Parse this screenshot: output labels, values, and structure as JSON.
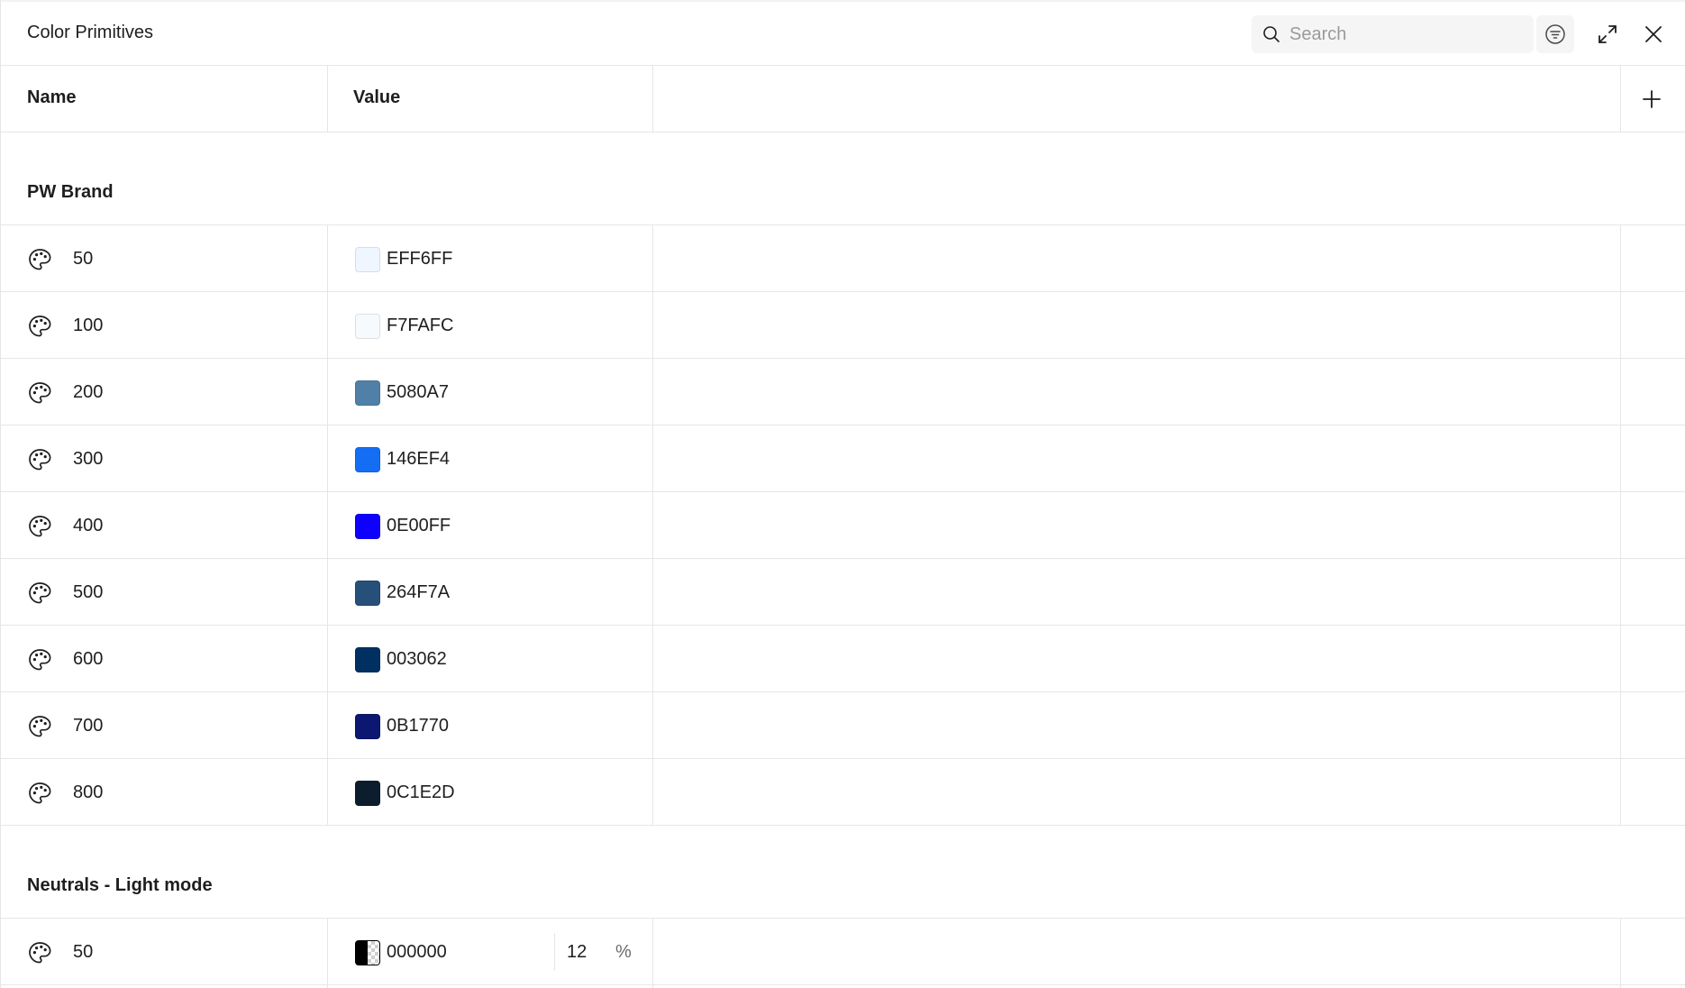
{
  "header": {
    "title": "Color Primitives",
    "search_placeholder": "Search"
  },
  "columns": {
    "name": "Name",
    "value": "Value"
  },
  "groups": [
    {
      "name": "PW Brand",
      "rows": [
        {
          "name": "50",
          "hex": "EFF6FF",
          "color": "#EFF6FF"
        },
        {
          "name": "100",
          "hex": "F7FAFC",
          "color": "#F7FAFC"
        },
        {
          "name": "200",
          "hex": "5080A7",
          "color": "#5080A7"
        },
        {
          "name": "300",
          "hex": "146EF4",
          "color": "#146EF4"
        },
        {
          "name": "400",
          "hex": "0E00FF",
          "color": "#0E00FF"
        },
        {
          "name": "500",
          "hex": "264F7A",
          "color": "#264F7A"
        },
        {
          "name": "600",
          "hex": "003062",
          "color": "#003062"
        },
        {
          "name": "700",
          "hex": "0B1770",
          "color": "#0B1770"
        },
        {
          "name": "800",
          "hex": "0C1E2D",
          "color": "#0C1E2D"
        }
      ]
    },
    {
      "name": "Neutrals - Light mode",
      "rows": [
        {
          "name": "50",
          "hex": "000000",
          "color": "#000000",
          "alpha": "12",
          "alpha_unit": "%"
        }
      ]
    }
  ]
}
